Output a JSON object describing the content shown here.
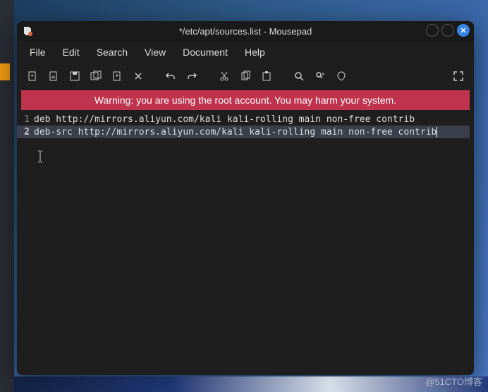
{
  "window": {
    "title": "*/etc/apt/sources.list - Mousepad"
  },
  "menu": {
    "file": "File",
    "edit": "Edit",
    "search": "Search",
    "view": "View",
    "document": "Document",
    "help": "Help"
  },
  "warning": "Warning: you are using the root account. You may harm your system.",
  "editor": {
    "lines": [
      {
        "num": "1",
        "text": "deb http://mirrors.aliyun.com/kali kali-rolling main non-free contrib"
      },
      {
        "num": "2",
        "text": "deb-src http://mirrors.aliyun.com/kali kali-rolling main non-free contrib"
      }
    ]
  },
  "watermark": "@51CTO博客"
}
